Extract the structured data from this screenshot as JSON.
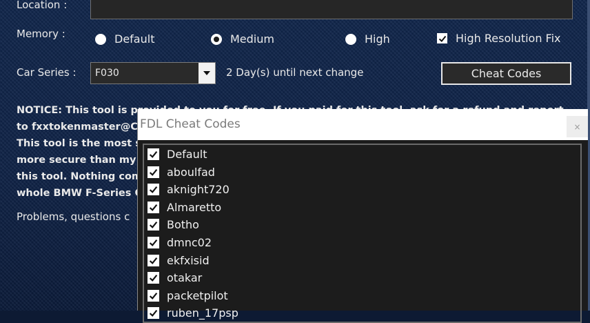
{
  "form": {
    "location_label": "Location :",
    "memory_label": "Memory :",
    "memory_options": [
      "Default",
      "Medium",
      "High"
    ],
    "memory_selected": "Medium",
    "hires_label": "High Resolution Fix",
    "hires_checked": true,
    "car_series_label": "Car Series :",
    "car_series_value": "F030",
    "next_change": "2 Day(s) until next change",
    "cheat_codes_button": "Cheat Codes"
  },
  "notice": {
    "lines": [
      "NOTICE: This tool is provided to you for free. If you paid for this tool, ask for a refund and report",
      "to fxxtokenmaster@C",
      "This tool is the most s",
      "more secure than my",
      "this tool. Nothing com",
      "whole BMW F-Series C"
    ],
    "problems": "Problems, questions c"
  },
  "dialog": {
    "title": "FDL Cheat Codes",
    "close_label": "×",
    "items": [
      {
        "label": "Default",
        "checked": true
      },
      {
        "label": "aboulfad",
        "checked": true
      },
      {
        "label": "aknight720",
        "checked": true
      },
      {
        "label": "Almaretto",
        "checked": true
      },
      {
        "label": "Botho",
        "checked": true
      },
      {
        "label": "dmnc02",
        "checked": true
      },
      {
        "label": "ekfxisid",
        "checked": true
      },
      {
        "label": "otakar",
        "checked": true
      },
      {
        "label": "packetpilot",
        "checked": true
      },
      {
        "label": "ruben_17psp",
        "checked": true
      }
    ]
  }
}
